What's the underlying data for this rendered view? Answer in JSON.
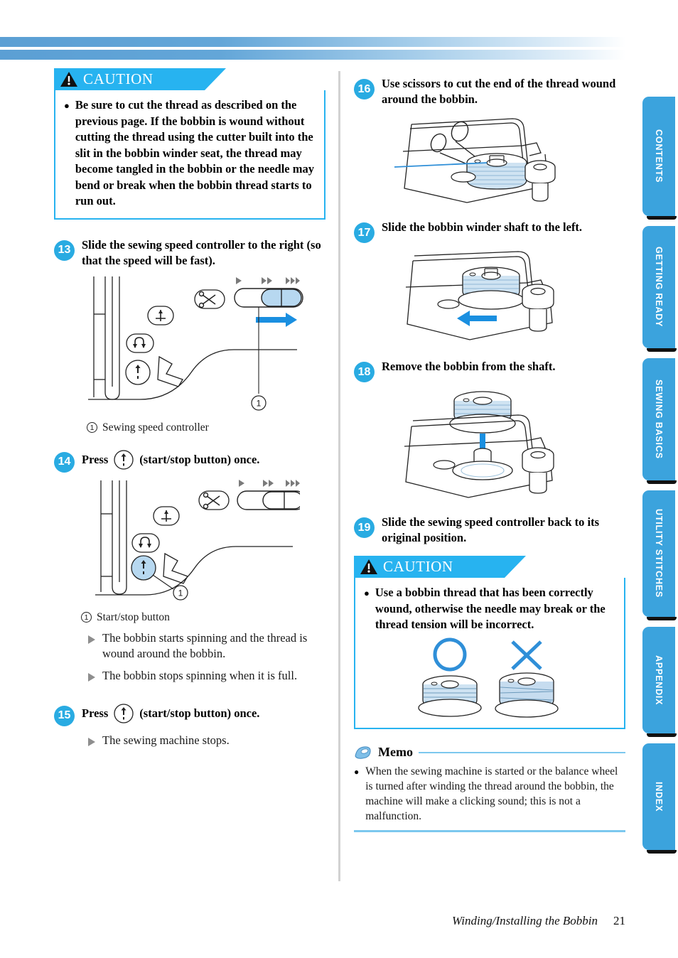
{
  "document": {
    "footer_title": "Winding/Installing the Bobbin",
    "page_number": "21"
  },
  "side_tabs": [
    {
      "label": "CONTENTS"
    },
    {
      "label": "GETTING READY"
    },
    {
      "label": "SEWING BASICS"
    },
    {
      "label": "UTILITY STITCHES"
    },
    {
      "label": "APPENDIX"
    },
    {
      "label": "INDEX"
    }
  ],
  "left_column": {
    "caution": {
      "heading": "CAUTION",
      "bullet": "Be sure to cut the thread as described on the previous page. If the bobbin is wound without cutting the thread using the cutter built into the slit in the bobbin winder seat, the thread may become tangled in the bobbin or the needle may bend or break when the bobbin thread starts to run out."
    },
    "step13": {
      "number": "13",
      "text": "Slide the sewing speed controller to the right (so that the speed will be fast).",
      "caption_number": "1",
      "caption": "Sewing speed controller",
      "speed_marks": [
        "►",
        "►►",
        "►►►"
      ]
    },
    "step14": {
      "number": "14",
      "text_before": "Press",
      "text_after": "(start/stop button) once.",
      "caption_number": "1",
      "caption": "Start/stop button",
      "speed_marks": [
        "►",
        "►►",
        "►►►"
      ],
      "results": [
        "The bobbin starts spinning and the thread is wound around the bobbin.",
        "The bobbin stops spinning when it is full."
      ]
    },
    "step15": {
      "number": "15",
      "text_before": "Press",
      "text_after": "(start/stop button) once.",
      "results": [
        "The sewing machine stops."
      ]
    }
  },
  "right_column": {
    "step16": {
      "number": "16",
      "text": "Use scissors to cut the end of the thread wound around the bobbin."
    },
    "step17": {
      "number": "17",
      "text": "Slide the bobbin winder shaft to the left."
    },
    "step18": {
      "number": "18",
      "text": "Remove the bobbin from the shaft."
    },
    "step19": {
      "number": "19",
      "text": "Slide the sewing speed controller back to its original position."
    },
    "caution": {
      "heading": "CAUTION",
      "bullet": "Use a bobbin thread that has been correctly wound, otherwise the needle may break or the thread tension will be incorrect.",
      "correct_mark": "circle-ok-icon",
      "incorrect_mark": "cross-ng-icon"
    },
    "memo": {
      "heading": "Memo",
      "bullet": "When the sewing machine is started or the balance wheel is turned after winding the thread around the bobbin, the machine will make a clicking sound; this is not a malfunction."
    }
  },
  "colors": {
    "accent_cyan": "#27b3f0",
    "badge_blue": "#29abe2",
    "tab_blue": "#3ba3dd",
    "memo_rule": "#7cc8ee"
  }
}
